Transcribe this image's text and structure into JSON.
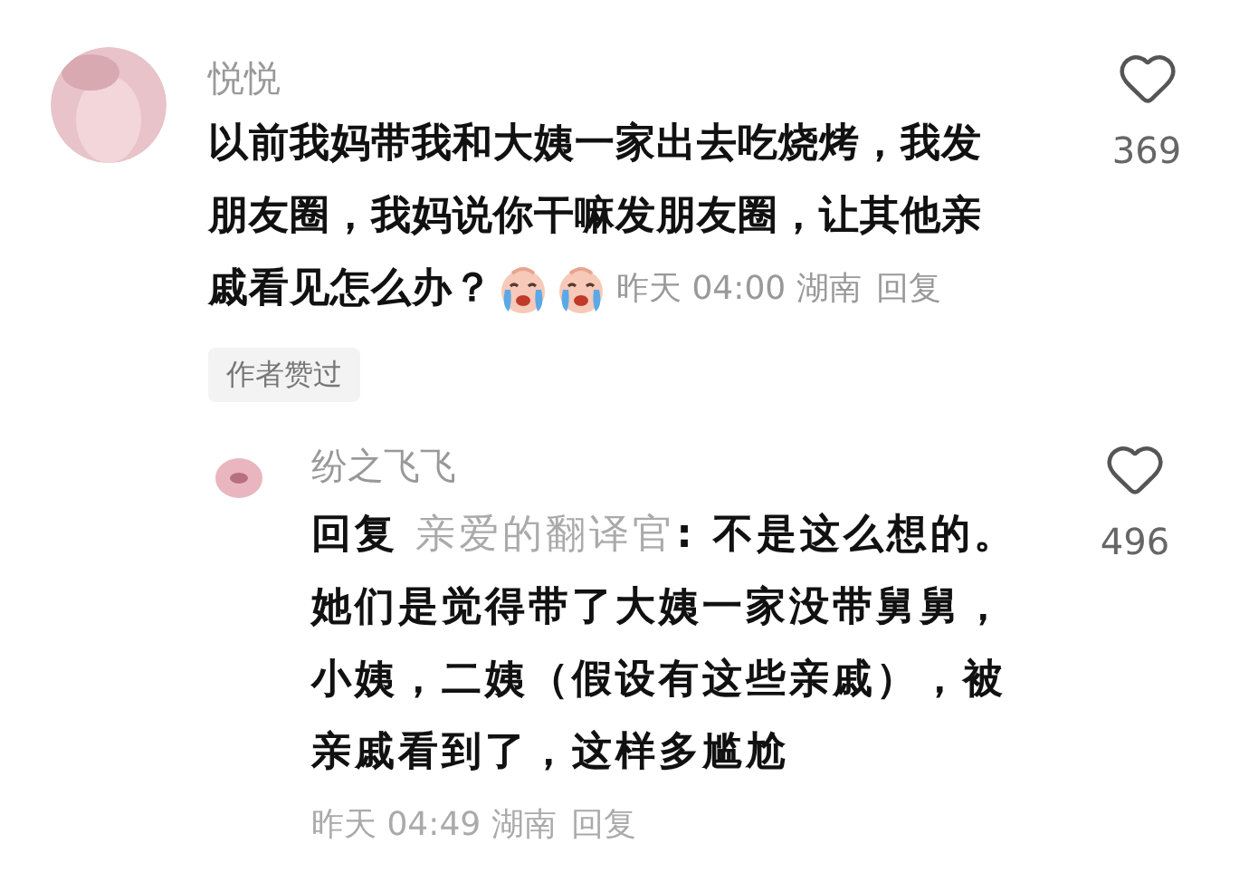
{
  "comments": [
    {
      "author": "悦悦",
      "text_lines": [
        "以前我妈带我和大姨一家出去吃烧烤，我发",
        "朋友圈，我妈说你干嘛发朋友圈，让其他亲",
        "戚看见怎么办？"
      ],
      "emojis": [
        {
          "kind": "crying_face"
        },
        {
          "kind": "crying_face"
        }
      ],
      "time_place": "昨天 04:00 湖南",
      "reply_action": "回复",
      "badge": "作者赞过",
      "liked": false,
      "likes": "369",
      "replies": [
        {
          "author": "纷之飞飞",
          "reply_prefix": "回复",
          "reply_to": "亲爱的翻译官",
          "text": ": 不是这么想的。她们是觉得带了大姨一家没带舅舅，小姨，二姨（假设有这些亲戚），被亲戚看到了，这样多尴尬",
          "time_place": "昨天 04:49 湖南",
          "reply_action": "回复",
          "liked": false,
          "likes": "496"
        }
      ]
    }
  ]
}
